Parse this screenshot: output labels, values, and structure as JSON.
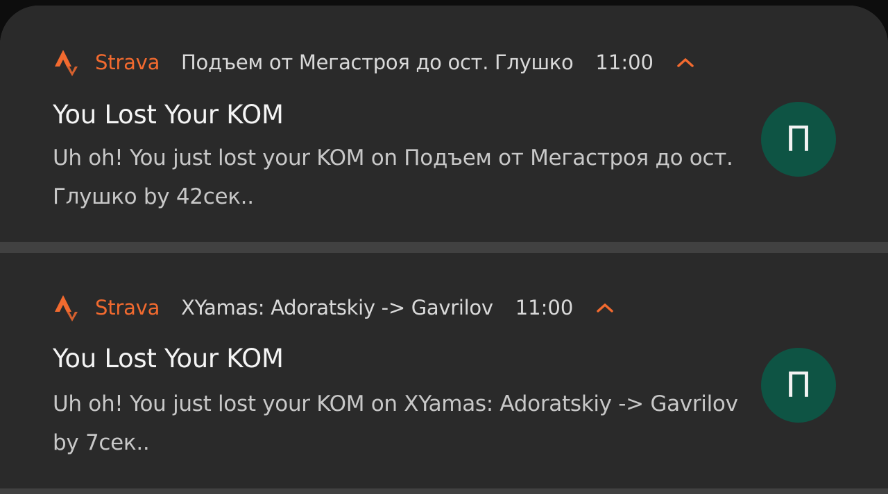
{
  "accent_color": "#f26a2f",
  "avatar_color": "#0e5444",
  "notifications": [
    {
      "app_icon": "strava-logo-icon",
      "app_name": "Strava",
      "subtext": "Подъем от Мегастроя до ост. Глушко",
      "time": "11:00",
      "expand_icon": "chevron-up-icon",
      "title": "You Lost Your KOM",
      "body": "Uh oh! You just lost your KOM on Подъем от Мегастроя до ост. Глушко by 42сек..",
      "avatar_letter": "П"
    },
    {
      "app_icon": "strava-logo-icon",
      "app_name": "Strava",
      "subtext": "XYamas: Adoratskiy -> Gavrilov",
      "time": "11:00",
      "expand_icon": "chevron-up-icon",
      "title": "You Lost Your KOM",
      "body": "Uh oh! You just lost your KOM on XYamas: Adoratskiy -> Gavrilov by 7сек..",
      "avatar_letter": "П"
    }
  ]
}
